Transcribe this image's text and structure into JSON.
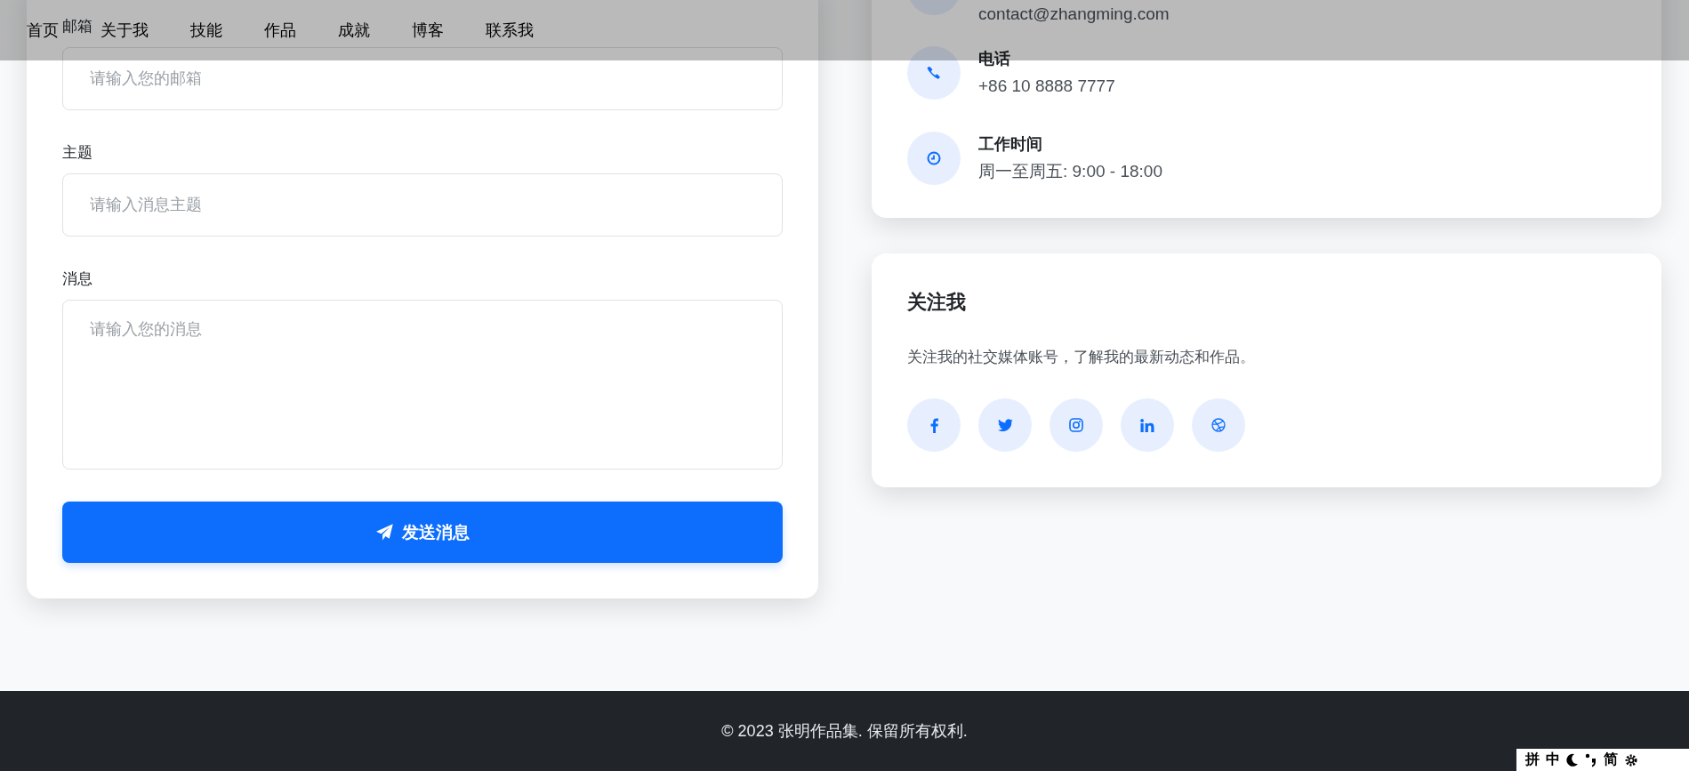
{
  "nav": {
    "items": [
      "首页",
      "关于我",
      "技能",
      "作品",
      "成就",
      "博客",
      "联系我"
    ]
  },
  "contact_form": {
    "fields": [
      {
        "kind": "input",
        "label": "邮箱",
        "placeholder": "请输入您的邮箱"
      },
      {
        "kind": "input",
        "label": "主题",
        "placeholder": "请输入消息主题"
      },
      {
        "kind": "textarea",
        "label": "消息",
        "placeholder": "请输入您的消息"
      }
    ],
    "submit_button": "发送消息"
  },
  "contact_info": {
    "items": [
      {
        "kind": "email",
        "value": "contact@zhangming.com"
      },
      {
        "kind": "phone",
        "title": "电话",
        "value": "+86 10 8888 7777"
      },
      {
        "kind": "clock",
        "title": "工作时间",
        "value": "周一至周五: 9:00 - 18:00"
      }
    ]
  },
  "follow": {
    "title": "关注我",
    "description": "关注我的社交媒体账号，了解我的最新动态和作品。",
    "social_links": [
      {
        "kind": "facebook"
      },
      {
        "kind": "twitter"
      },
      {
        "kind": "instagram"
      },
      {
        "kind": "linkedin"
      },
      {
        "kind": "dribbble"
      }
    ]
  },
  "footer": {
    "text": "© 2023 张明作品集. 保留所有权利."
  },
  "ime_toolbar": {
    "items": [
      {
        "kind": "text",
        "text": "拼"
      },
      {
        "kind": "text",
        "text": "中"
      },
      {
        "kind": "moon"
      },
      {
        "kind": "punct"
      },
      {
        "kind": "text",
        "text": "简"
      },
      {
        "kind": "gear"
      }
    ]
  }
}
